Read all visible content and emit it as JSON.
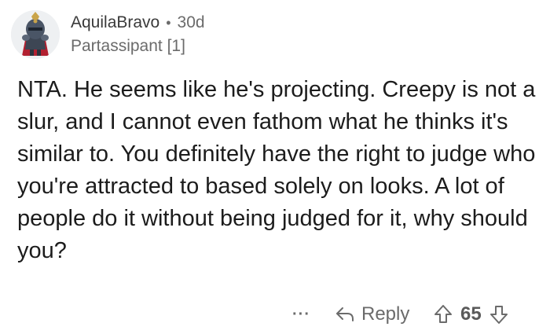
{
  "comment": {
    "author": "AquilaBravo",
    "separator": "•",
    "age": "30d",
    "flair": "Partassipant [1]",
    "body": "NTA. He seems like he's projecting. Creepy is not a slur, and I cannot even fathom what he thinks it's similar to. You definitely have the right to judge who you're attracted to based solely on looks. A lot of people do it without being judged for it, why should you?"
  },
  "actions": {
    "more_label": "···",
    "reply_label": "Reply",
    "score": "65"
  },
  "icons": {
    "reply": "reply-arrow-icon",
    "upvote": "upvote-arrow-icon",
    "downvote": "downvote-arrow-icon",
    "more": "more-options-icon"
  },
  "colors": {
    "text": "#1c1c1c",
    "meta": "#6b6b6b",
    "avatar_bg": "#eef0f2"
  }
}
